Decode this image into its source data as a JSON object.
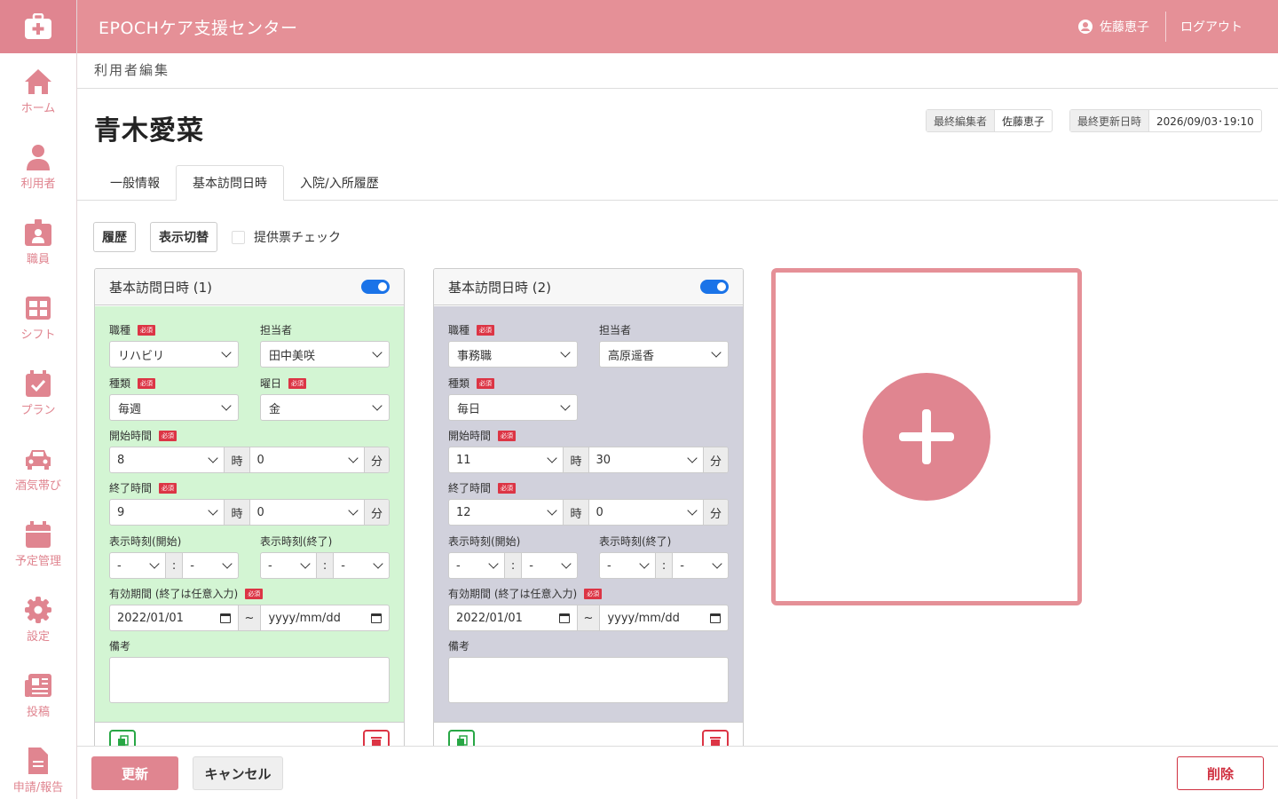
{
  "app": {
    "title": "EPOCHケア支援センター",
    "user": "佐藤恵子",
    "logout": "ログアウト"
  },
  "nav": [
    {
      "label": "ホーム",
      "icon": "home-icon"
    },
    {
      "label": "利用者",
      "icon": "person-icon"
    },
    {
      "label": "職員",
      "icon": "badge-icon"
    },
    {
      "label": "シフト",
      "icon": "grid-icon"
    },
    {
      "label": "プラン",
      "icon": "calendar-check-icon"
    },
    {
      "label": "酒気帯び",
      "icon": "car-icon"
    },
    {
      "label": "予定管理",
      "icon": "calendar-icon"
    },
    {
      "label": "設定",
      "icon": "gear-icon"
    },
    {
      "label": "投稿",
      "icon": "newspaper-icon"
    },
    {
      "label": "申請/報告",
      "icon": "document-icon"
    }
  ],
  "breadcrumb": "利用者編集",
  "patient_name": "青木愛菜",
  "meta": {
    "editor_label": "最終編集者",
    "editor": "佐藤恵子",
    "updated_label": "最終更新日時",
    "updated": "2026/09/03･19:10"
  },
  "tabs": [
    "一般情報",
    "基本訪問日時",
    "入院/入所履歴"
  ],
  "toolbar": {
    "history": "履歴",
    "toggle_view": "表示切替",
    "check": "提供票チェック"
  },
  "labels": {
    "job": "職種",
    "staff": "担当者",
    "kind": "種類",
    "weekday": "曜日",
    "start": "開始時間",
    "end": "終了時間",
    "disp_start": "表示時刻(開始)",
    "disp_end": "表示時刻(終了)",
    "period": "有効期間 (終了は任意入力)",
    "note": "備考",
    "required": "必須",
    "hour": "時",
    "minute": "分",
    "colon": ":",
    "tilde": "~",
    "dash": "-"
  },
  "cards": [
    {
      "title": "基本訪問日時 (1)",
      "job": "リハビリ",
      "staff": "田中美咲",
      "kind": "毎週",
      "weekday": "金",
      "start_h": "8",
      "start_m": "0",
      "end_h": "9",
      "end_m": "0",
      "period_start": "2022/01/01",
      "period_end": "yyyy/mm/dd",
      "color": "#d3f5d3"
    },
    {
      "title": "基本訪問日時 (2)",
      "job": "事務職",
      "staff": "高原遥香",
      "kind": "毎日",
      "weekday": "",
      "start_h": "11",
      "start_m": "30",
      "end_h": "12",
      "end_m": "0",
      "period_start": "2022/01/01",
      "period_end": "yyyy/mm/dd",
      "color": "#d1d1dc"
    }
  ],
  "footer": {
    "update": "更新",
    "cancel": "キャンセル",
    "delete": "削除"
  },
  "colors": {
    "accent": "#e08590",
    "header": "#e59097",
    "danger": "#dc3545",
    "toggle": "#1a73e8"
  }
}
